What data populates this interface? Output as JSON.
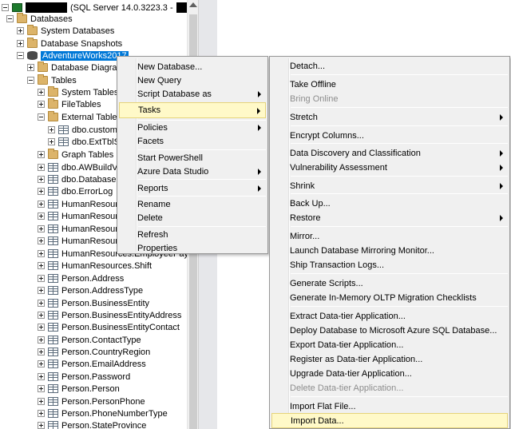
{
  "tree": {
    "server_suffix": "(SQL Server 14.0.3223.3 -",
    "items": [
      {
        "label": "Databases"
      },
      {
        "label": "System Databases"
      },
      {
        "label": "Database Snapshots"
      },
      {
        "label": "AdventureWorks2017"
      },
      {
        "label": "Database Diagrams"
      },
      {
        "label": "Tables"
      },
      {
        "label": "System Tables"
      },
      {
        "label": "FileTables"
      },
      {
        "label": "External Tables"
      },
      {
        "label": "dbo.customer"
      },
      {
        "label": "dbo.ExtTblSa"
      },
      {
        "label": "Graph Tables"
      },
      {
        "label": "dbo.AWBuildVe"
      },
      {
        "label": "dbo.DatabaseL"
      },
      {
        "label": "dbo.ErrorLog"
      },
      {
        "label": "HumanResourc"
      },
      {
        "label": "HumanResourc"
      },
      {
        "label": "HumanResourc"
      },
      {
        "label": "HumanResourc"
      },
      {
        "label": "HumanResources.EmployeePayHistory"
      },
      {
        "label": "HumanResources.Shift"
      },
      {
        "label": "Person.Address"
      },
      {
        "label": "Person.AddressType"
      },
      {
        "label": "Person.BusinessEntity"
      },
      {
        "label": "Person.BusinessEntityAddress"
      },
      {
        "label": "Person.BusinessEntityContact"
      },
      {
        "label": "Person.ContactType"
      },
      {
        "label": "Person.CountryRegion"
      },
      {
        "label": "Person.EmailAddress"
      },
      {
        "label": "Person.Password"
      },
      {
        "label": "Person.Person"
      },
      {
        "label": "Person.PersonPhone"
      },
      {
        "label": "Person.PhoneNumberType"
      },
      {
        "label": "Person.StateProvince"
      }
    ]
  },
  "menu1": {
    "items": [
      {
        "label": "New Database..."
      },
      {
        "label": "New Query"
      },
      {
        "label": "Script Database as"
      },
      {
        "label": "Tasks"
      },
      {
        "label": "Policies"
      },
      {
        "label": "Facets"
      },
      {
        "label": "Start PowerShell"
      },
      {
        "label": "Azure Data Studio"
      },
      {
        "label": "Reports"
      },
      {
        "label": "Rename"
      },
      {
        "label": "Delete"
      },
      {
        "label": "Refresh"
      },
      {
        "label": "Properties"
      }
    ]
  },
  "menu2": {
    "items": [
      {
        "label": "Detach..."
      },
      {
        "label": "Take Offline"
      },
      {
        "label": "Bring Online"
      },
      {
        "label": "Stretch"
      },
      {
        "label": "Encrypt Columns..."
      },
      {
        "label": "Data Discovery and Classification"
      },
      {
        "label": "Vulnerability Assessment"
      },
      {
        "label": "Shrink"
      },
      {
        "label": "Back Up..."
      },
      {
        "label": "Restore"
      },
      {
        "label": "Mirror..."
      },
      {
        "label": "Launch Database Mirroring Monitor..."
      },
      {
        "label": "Ship Transaction Logs..."
      },
      {
        "label": "Generate Scripts..."
      },
      {
        "label": "Generate In-Memory OLTP Migration Checklists"
      },
      {
        "label": "Extract Data-tier Application..."
      },
      {
        "label": "Deploy Database to Microsoft Azure SQL Database..."
      },
      {
        "label": "Export Data-tier Application..."
      },
      {
        "label": "Register as Data-tier Application..."
      },
      {
        "label": "Upgrade Data-tier Application..."
      },
      {
        "label": "Delete Data-tier Application..."
      },
      {
        "label": "Import Flat File..."
      },
      {
        "label": "Import Data..."
      }
    ]
  }
}
